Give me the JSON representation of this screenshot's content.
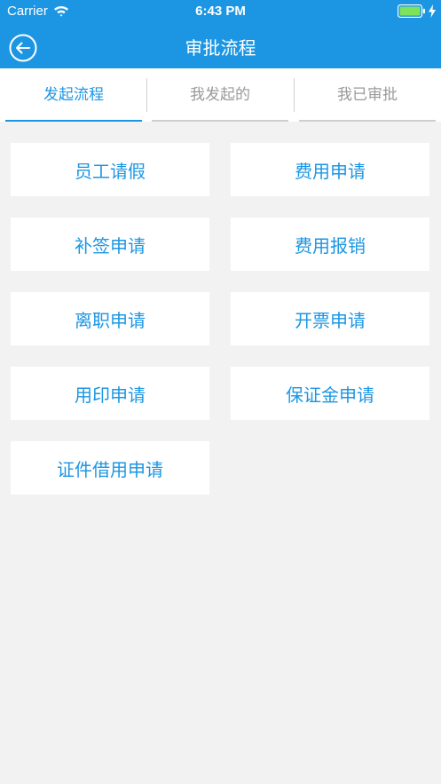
{
  "status_bar": {
    "carrier": "Carrier",
    "time": "6:43 PM"
  },
  "nav": {
    "title": "审批流程",
    "back_icon": "back-arrow-circle-icon"
  },
  "tabs": [
    {
      "label": "发起流程",
      "active": true
    },
    {
      "label": "我发起的",
      "active": false
    },
    {
      "label": "我已审批",
      "active": false
    }
  ],
  "requests": [
    "员工请假",
    "费用申请",
    "补签申请",
    "费用报销",
    "离职申请",
    "开票申请",
    "用印申请",
    "保证金申请",
    "证件借用申请"
  ],
  "colors": {
    "primary": "#1c96e3",
    "background": "#f2f2f2",
    "tab_inactive": "#9a9a9a"
  }
}
